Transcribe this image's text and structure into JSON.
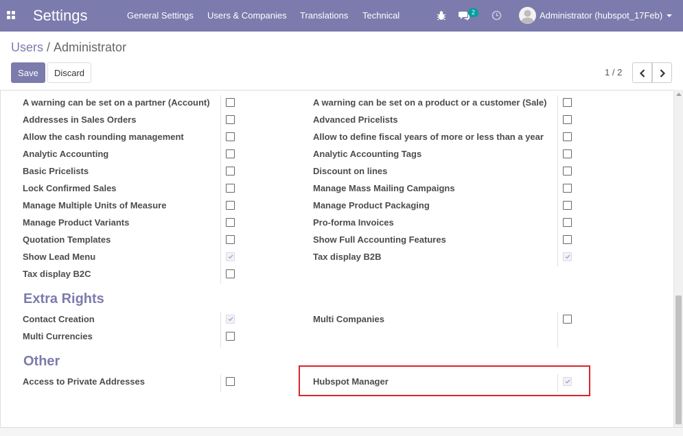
{
  "navbar": {
    "app_title": "Settings",
    "menu": [
      "General Settings",
      "Users & Companies",
      "Translations",
      "Technical"
    ],
    "chat_count": "2",
    "user_name": "Administrator (hubspot_17Feb)",
    "color": "#7c7bad"
  },
  "breadcrumb": {
    "parent": "Users",
    "separator": "/",
    "current": "Administrator"
  },
  "toolbar": {
    "save_label": "Save",
    "discard_label": "Discard"
  },
  "pager": {
    "value": "1 / 2"
  },
  "technical_settings": {
    "left": [
      {
        "label": "A warning can be set on a partner (Account)",
        "checked": false
      },
      {
        "label": "Addresses in Sales Orders",
        "checked": false
      },
      {
        "label": "Allow the cash rounding management",
        "checked": false
      },
      {
        "label": "Analytic Accounting",
        "checked": false
      },
      {
        "label": "Basic Pricelists",
        "checked": false
      },
      {
        "label": "Lock Confirmed Sales",
        "checked": false
      },
      {
        "label": "Manage Multiple Units of Measure",
        "checked": false
      },
      {
        "label": "Manage Product Variants",
        "checked": false
      },
      {
        "label": "Quotation Templates",
        "checked": false
      },
      {
        "label": "Show Lead Menu",
        "checked": true
      },
      {
        "label": "Tax display B2C",
        "checked": false
      }
    ],
    "right": [
      {
        "label": "A warning can be set on a product or a customer (Sale)",
        "checked": false
      },
      {
        "label": "Advanced Pricelists",
        "checked": false
      },
      {
        "label": "Allow to define fiscal years of more or less than a year",
        "checked": false
      },
      {
        "label": "Analytic Accounting Tags",
        "checked": false
      },
      {
        "label": "Discount on lines",
        "checked": false
      },
      {
        "label": "Manage Mass Mailing Campaigns",
        "checked": false
      },
      {
        "label": "Manage Product Packaging",
        "checked": false
      },
      {
        "label": "Pro-forma Invoices",
        "checked": false
      },
      {
        "label": "Show Full Accounting Features",
        "checked": false
      },
      {
        "label": "Tax display B2B",
        "checked": true
      }
    ]
  },
  "extra_rights": {
    "title": "Extra Rights",
    "left": [
      {
        "label": "Contact Creation",
        "checked": true
      },
      {
        "label": "Multi Currencies",
        "checked": false
      }
    ],
    "right": [
      {
        "label": "Multi Companies",
        "checked": false
      }
    ]
  },
  "other": {
    "title": "Other",
    "left": [
      {
        "label": "Access to Private Addresses",
        "checked": false
      }
    ],
    "right": [
      {
        "label": "Hubspot Manager",
        "checked": true
      }
    ]
  }
}
